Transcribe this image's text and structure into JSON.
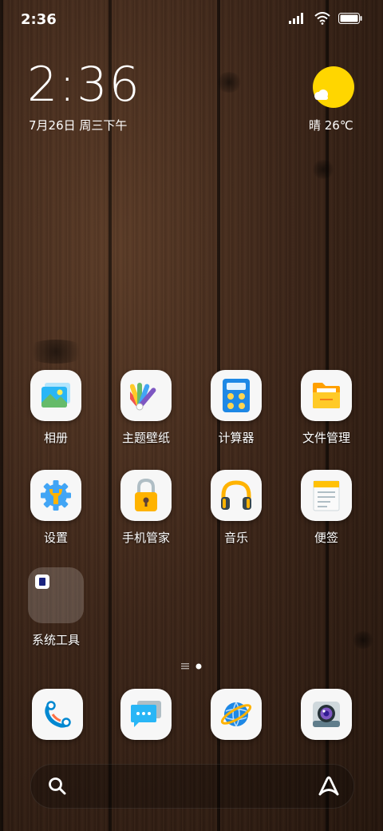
{
  "status_bar": {
    "time": "2:36"
  },
  "clock_widget": {
    "time": "2:36",
    "date": "7月26日 周三下午"
  },
  "weather_widget": {
    "text": "晴 26℃"
  },
  "apps": [
    {
      "label": "相册",
      "icon": "gallery-icon"
    },
    {
      "label": "主题壁纸",
      "icon": "themes-icon"
    },
    {
      "label": "计算器",
      "icon": "calculator-icon"
    },
    {
      "label": "文件管理",
      "icon": "file-manager-icon"
    },
    {
      "label": "设置",
      "icon": "settings-gear-icon"
    },
    {
      "label": "手机管家",
      "icon": "security-lock-icon"
    },
    {
      "label": "音乐",
      "icon": "headphones-icon"
    },
    {
      "label": "便签",
      "icon": "notes-icon"
    }
  ],
  "folder": {
    "label": "系统工具"
  },
  "dock": [
    {
      "icon": "phone-icon"
    },
    {
      "icon": "messages-icon"
    },
    {
      "icon": "browser-icon"
    },
    {
      "icon": "camera-icon"
    }
  ],
  "page_indicator": {
    "current_page": 1,
    "total_pages": 1
  },
  "colors": {
    "weather_sun": "#ffd600",
    "calculator_blue": "#1e88e5",
    "folder_yellow": "#ffc107"
  }
}
